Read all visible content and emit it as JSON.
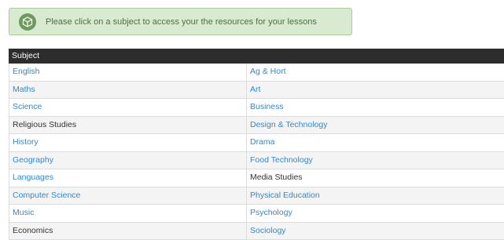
{
  "notice": {
    "text": "Please click on a subject to access your the resources for your lessons",
    "icon": "cube-icon"
  },
  "table": {
    "header": "Subject",
    "colors": {
      "link": "#3388cc",
      "plain": "#333333",
      "header_bg": "#2d2d2d"
    },
    "rows": [
      {
        "left": {
          "label": "English",
          "link": true
        },
        "right": {
          "label": "Ag & Hort",
          "link": true
        }
      },
      {
        "left": {
          "label": "Maths",
          "link": true
        },
        "right": {
          "label": "Art",
          "link": true
        }
      },
      {
        "left": {
          "label": "Science",
          "link": true
        },
        "right": {
          "label": "Business",
          "link": true
        }
      },
      {
        "left": {
          "label": "Religious Studies",
          "link": false
        },
        "right": {
          "label": "Design & Technology",
          "link": true
        }
      },
      {
        "left": {
          "label": "History",
          "link": true
        },
        "right": {
          "label": "Drama",
          "link": true
        }
      },
      {
        "left": {
          "label": "Geography",
          "link": true
        },
        "right": {
          "label": "Food Technology",
          "link": true
        }
      },
      {
        "left": {
          "label": "Languages",
          "link": true
        },
        "right": {
          "label": "Media Studies",
          "link": false
        }
      },
      {
        "left": {
          "label": "Computer Science",
          "link": true
        },
        "right": {
          "label": "Physical Education",
          "link": true
        }
      },
      {
        "left": {
          "label": "Music",
          "link": true
        },
        "right": {
          "label": "Psychology",
          "link": true
        }
      },
      {
        "left": {
          "label": "Economics",
          "link": false
        },
        "right": {
          "label": "Sociology",
          "link": true
        }
      }
    ]
  }
}
